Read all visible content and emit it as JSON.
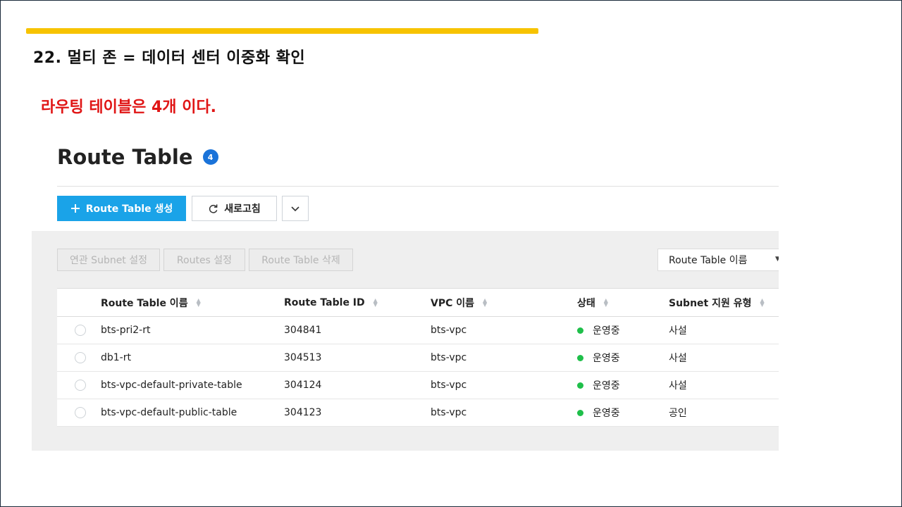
{
  "slide": {
    "title": "22. 멀티 존 = 데이터 센터 이중화 확인",
    "annotation": "라우팅 테이블은 4개 이다.",
    "accent_color": "#f7c300",
    "annotation_color": "#e01515"
  },
  "console": {
    "heading": "Route Table",
    "count": "4",
    "toolbar": {
      "create_label": "Route Table 생성",
      "create_icon": "plus-icon",
      "refresh_label": "새로고침",
      "refresh_icon": "refresh-icon",
      "more_icon": "chevron-down-icon"
    },
    "actions": {
      "assoc_subnet": "연관 Subnet 설정",
      "routes": "Routes 설정",
      "delete": "Route Table 삭제"
    },
    "filter": {
      "selected": "Route Table 이름"
    },
    "table": {
      "columns": [
        "Route Table 이름",
        "Route Table ID",
        "VPC 이름",
        "상태",
        "Subnet 지원 유형"
      ],
      "rows": [
        {
          "name": "bts-pri2-rt",
          "id": "304841",
          "vpc": "bts-vpc",
          "status": "운영중",
          "subnet_type": "사설"
        },
        {
          "name": "db1-rt",
          "id": "304513",
          "vpc": "bts-vpc",
          "status": "운영중",
          "subnet_type": "사설"
        },
        {
          "name": "bts-vpc-default-private-table",
          "id": "304124",
          "vpc": "bts-vpc",
          "status": "운영중",
          "subnet_type": "사설"
        },
        {
          "name": "bts-vpc-default-public-table",
          "id": "304123",
          "vpc": "bts-vpc",
          "status": "운영중",
          "subnet_type": "공인"
        }
      ]
    },
    "colors": {
      "primary": "#1aa3e8",
      "badge": "#1a73d9",
      "status_running": "#1fbf4a"
    }
  }
}
